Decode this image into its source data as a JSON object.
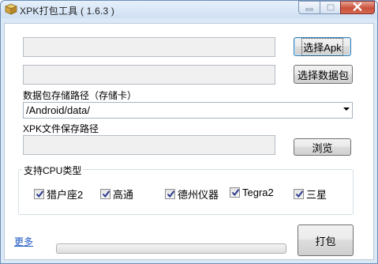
{
  "window": {
    "title": "XPK打包工具 ( 1.6.3 )",
    "accent_color": "#dbe8f6"
  },
  "apk": {
    "path_value": "",
    "select_apk_label": "选择Apk"
  },
  "data_package": {
    "path_value": "",
    "select_label": "选择数据包"
  },
  "storage_path": {
    "label": "数据包存储路径（存储卡）",
    "selected": "/Android/data/"
  },
  "xpk_save": {
    "label": "XPK文件保存路径",
    "path_value": "",
    "browse_label": "浏览"
  },
  "cpu": {
    "legend": "支持CPU类型",
    "options": [
      {
        "label": "猎户座2",
        "checked": true
      },
      {
        "label": "高通",
        "checked": true
      },
      {
        "label": "德州仪器",
        "checked": true
      },
      {
        "label": "Tegra2",
        "checked": true
      },
      {
        "label": "三星",
        "checked": true
      }
    ]
  },
  "footer": {
    "more_link": "更多",
    "pack_label": "打包",
    "progress": 0
  }
}
